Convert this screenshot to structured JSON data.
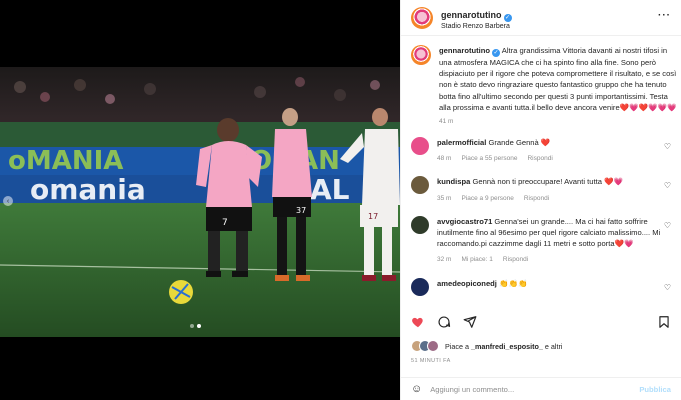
{
  "post": {
    "username": "gennarotutino",
    "location": "Stadio Renzo Barbera",
    "more_icon": "more-icon"
  },
  "caption": {
    "username": "gennarotutino",
    "text": "Altra grandissima Vittoria davanti ai nostri tifosi in una atmosfera MAGICA che ci ha spinto fino alla fine. Sono però dispiaciuto per il rigore che poteva compromettere il risultato, e se così non è stato devo ringraziare questo fantastico gruppo che ha tenuto botta fino all'ultimo secondo per questi 3 punti importantissimi. Testa alla prossima e avanti tutta.il bello deve ancora venire❤️💗❤️💗💗💗",
    "time": "41 m"
  },
  "comments": [
    {
      "username": "palermofficial",
      "text": "Grande Gennà ❤️",
      "time": "48 m",
      "likes": "Piace a 55 persone",
      "reply": "Rispondi",
      "color": "#e84e8a"
    },
    {
      "username": "kundispa",
      "text": "Gennà non ti preoccupare! Avanti tutta ❤️💗",
      "time": "35 m",
      "likes": "Piace a 9 persone",
      "reply": "Rispondi",
      "color": "#6b5a3c"
    },
    {
      "username": "avvgiocastro71",
      "text": "Genna'sei un grande.... Ma ci hai fatto soffrire inutilmente fino al 96esimo per quel rigore calciato malissimo.... Mi raccomando.pi cazzimme dagli 11 metri e sotto porta❤️💗",
      "time": "32 m",
      "likes": "Mi piace: 1",
      "reply": "Rispondi",
      "color": "#2f3b2a"
    },
    {
      "username": "amedeopiconedj",
      "text": "👏👏👏",
      "time": "",
      "likes": "",
      "reply": "",
      "color": "#1a2a5a"
    }
  ],
  "actions": {
    "like_icon": "heart-icon",
    "comment_icon": "comment-icon",
    "share_icon": "share-icon",
    "save_icon": "bookmark-icon"
  },
  "likes_line": {
    "prefix": "Piace a ",
    "user": "_manfredi_esposito_",
    "suffix": " e altri"
  },
  "posted_time": "51 MINUTI FA",
  "composer": {
    "placeholder": "Aggiungi un commento...",
    "publish_label": "Pubblica",
    "emoji_icon": "emoji-icon"
  },
  "media": {
    "slide_count": 2,
    "active_slide": 1,
    "banner_text": "oMANIA"
  },
  "colors": {
    "accent": "#0095f6",
    "like_red": "#ed4956",
    "kit_pink": "#f4a6c4",
    "pitch_green": "#2f5d2c",
    "banner_blue": "#1b57a8"
  }
}
